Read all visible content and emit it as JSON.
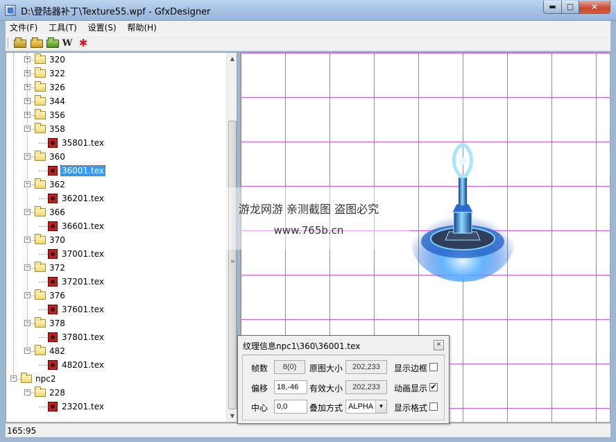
{
  "window": {
    "title": "D:\\登陆器补丁\\Texture55.wpf - GfxDesigner",
    "min_symbol": "▬",
    "max_symbol": "□",
    "close_symbol": "✕"
  },
  "menu": [
    "文件(F)",
    "工具(T)",
    "设置(S)",
    "帮助(H)"
  ],
  "toolbar": {
    "buttons": [
      "open-folder-icon",
      "import-folder-icon",
      "save-folder-icon",
      "w-icon",
      "red-cross-icon"
    ],
    "w_label": "W",
    "cross_label": "✱"
  },
  "tree": {
    "nodes": [
      {
        "label": "320",
        "type": "folder",
        "expander": "+"
      },
      {
        "label": "322",
        "type": "folder",
        "expander": "+"
      },
      {
        "label": "326",
        "type": "folder",
        "expander": "+"
      },
      {
        "label": "344",
        "type": "folder",
        "expander": "+"
      },
      {
        "label": "356",
        "type": "folder",
        "expander": "+"
      },
      {
        "label": "358",
        "type": "folder",
        "expander": "−"
      },
      {
        "label": "35801.tex",
        "type": "tex"
      },
      {
        "label": "360",
        "type": "folder",
        "expander": "−"
      },
      {
        "label": "36001.tex",
        "type": "tex",
        "selected": true
      },
      {
        "label": "362",
        "type": "folder",
        "expander": "−"
      },
      {
        "label": "36201.tex",
        "type": "tex"
      },
      {
        "label": "366",
        "type": "folder",
        "expander": "−"
      },
      {
        "label": "36601.tex",
        "type": "tex"
      },
      {
        "label": "370",
        "type": "folder",
        "expander": "−"
      },
      {
        "label": "37001.tex",
        "type": "tex"
      },
      {
        "label": "372",
        "type": "folder",
        "expander": "−"
      },
      {
        "label": "37201.tex",
        "type": "tex"
      },
      {
        "label": "376",
        "type": "folder",
        "expander": "−"
      },
      {
        "label": "37601.tex",
        "type": "tex"
      },
      {
        "label": "378",
        "type": "folder",
        "expander": "−"
      },
      {
        "label": "37801.tex",
        "type": "tex"
      },
      {
        "label": "482",
        "type": "folder",
        "expander": "−"
      },
      {
        "label": "48201.tex",
        "type": "tex"
      },
      {
        "label": "npc2",
        "type": "folder",
        "expander": "−",
        "root": true
      },
      {
        "label": "228",
        "type": "folder",
        "expander": "−"
      },
      {
        "label": "23201.tex",
        "type": "tex"
      }
    ]
  },
  "scrollbar": {
    "up": "▲",
    "down": "▼",
    "grip": "≡"
  },
  "watermark": {
    "line1": "游龙网游 亲测截图 盗图必究",
    "line2": "www.765b.cn"
  },
  "status": {
    "text": "165:95"
  },
  "info_dialog": {
    "title": "纹理信息npc1\\360\\36001.tex",
    "close_symbol": "✕",
    "frames_label": "帧数",
    "frames_value": "8(0)",
    "orig_size_label": "原图大小",
    "orig_size_value": "202,233",
    "show_border_label": "显示边框",
    "show_border_checked": false,
    "offset_label": "偏移",
    "offset_value": "18,-46",
    "valid_size_label": "有效大小",
    "valid_size_value": "202,233",
    "anim_label": "动画显示",
    "anim_checked": true,
    "center_label": "中心",
    "center_value": "0,0",
    "blend_label": "叠加方式",
    "blend_value": "ALPHA",
    "show_grid_label": "显示格式",
    "show_grid_checked": false
  }
}
